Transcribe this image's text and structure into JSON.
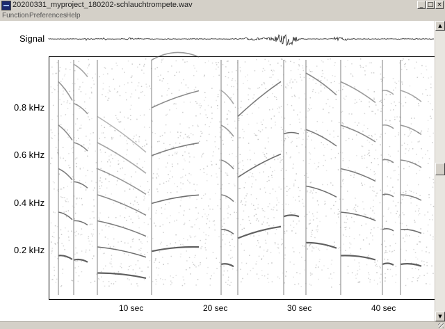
{
  "window": {
    "title": "20200331_myproject_180202-schlauchtrompete.wav",
    "minimize_label": "_",
    "maximize_label": "□",
    "close_label": "×"
  },
  "menu": {
    "items": [
      "Function",
      "Preferences",
      "Help"
    ]
  },
  "spectrogram": {
    "signal_label": "Signal",
    "y_ticks": [
      "0.8 kHz",
      "0.6 kHz",
      "0.4 kHz",
      "0.2 kHz"
    ],
    "x_ticks": [
      "10  sec",
      "20  sec",
      "30  sec",
      "40  sec"
    ]
  },
  "scrollbar": {
    "up_glyph": "▲",
    "down_glyph": "▼"
  },
  "colors": {
    "trace": "#333333",
    "noise": "#b5b5b5",
    "background": "#ffffff",
    "window_chrome": "#d4d0c8"
  }
}
